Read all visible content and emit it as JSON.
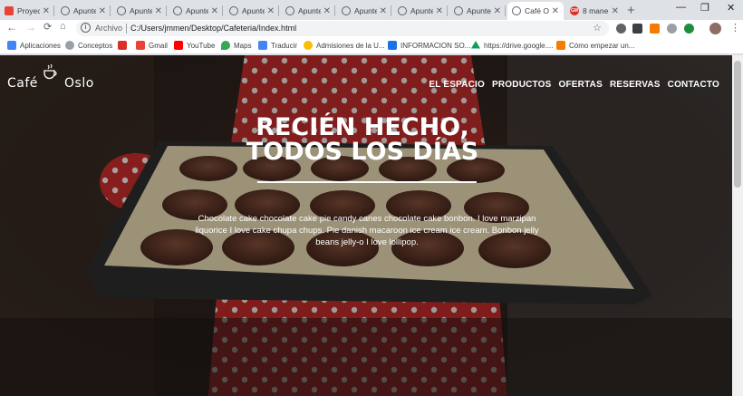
{
  "browser": {
    "tabs": [
      {
        "label": "Proyect",
        "icon": "calendar-icon"
      },
      {
        "label": "Apuntes",
        "icon": "globe-icon"
      },
      {
        "label": "Apuntes",
        "icon": "globe-icon"
      },
      {
        "label": "Apuntes",
        "icon": "globe-icon"
      },
      {
        "label": "Apuntes",
        "icon": "globe-icon"
      },
      {
        "label": "Apuntes",
        "icon": "globe-icon"
      },
      {
        "label": "Apuntes",
        "icon": "globe-icon"
      },
      {
        "label": "Apuntes",
        "icon": "globe-icon"
      },
      {
        "label": "Apuntes",
        "icon": "globe-icon"
      },
      {
        "label": "Café O",
        "icon": "globe-icon"
      },
      {
        "label": "8 mane",
        "icon": "site-icon"
      }
    ],
    "address": {
      "scheme": "Archivo",
      "url": "C:/Users/jmmen/Desktop/Cafeteria/Index.html"
    },
    "bookmarks": [
      {
        "label": "Aplicaciones",
        "color": "#4285f4"
      },
      {
        "label": "Conceptos",
        "color": "#9aa0a6"
      },
      {
        "label": "",
        "color": "#d93025"
      },
      {
        "label": "Gmail",
        "color": "#ea4335"
      },
      {
        "label": "YouTube",
        "color": "#ff0000"
      },
      {
        "label": "Maps",
        "color": "#34a853"
      },
      {
        "label": "Traducir",
        "color": "#4285f4"
      },
      {
        "label": "Admisiones de la U...",
        "color": "#fbbc04"
      },
      {
        "label": "INFORMACION SO...",
        "color": "#1a73e8"
      },
      {
        "label": "https://drive.google....",
        "color": "#0f9d58"
      },
      {
        "label": "Cómo empezar un...",
        "color": "#f57c00"
      }
    ]
  },
  "site": {
    "brand_left": "Café",
    "brand_right": "Oslo",
    "nav": [
      "EL ESPACIO",
      "PRODUCTOS",
      "OFERTAS",
      "RESERVAS",
      "CONTACTO"
    ],
    "hero": {
      "title_line1": "RECIÉN HECHO,",
      "title_line2": "TODOS LOS DÍAS",
      "text": "Chocolate cake chocolate cake pie candy canes chocolate cake bonbon. I love marzipan liquorice I love cake chupa chups. Pie danish macaroon ice cream ice cream. Bonbon jelly beans jelly-o I love lollipop."
    }
  }
}
